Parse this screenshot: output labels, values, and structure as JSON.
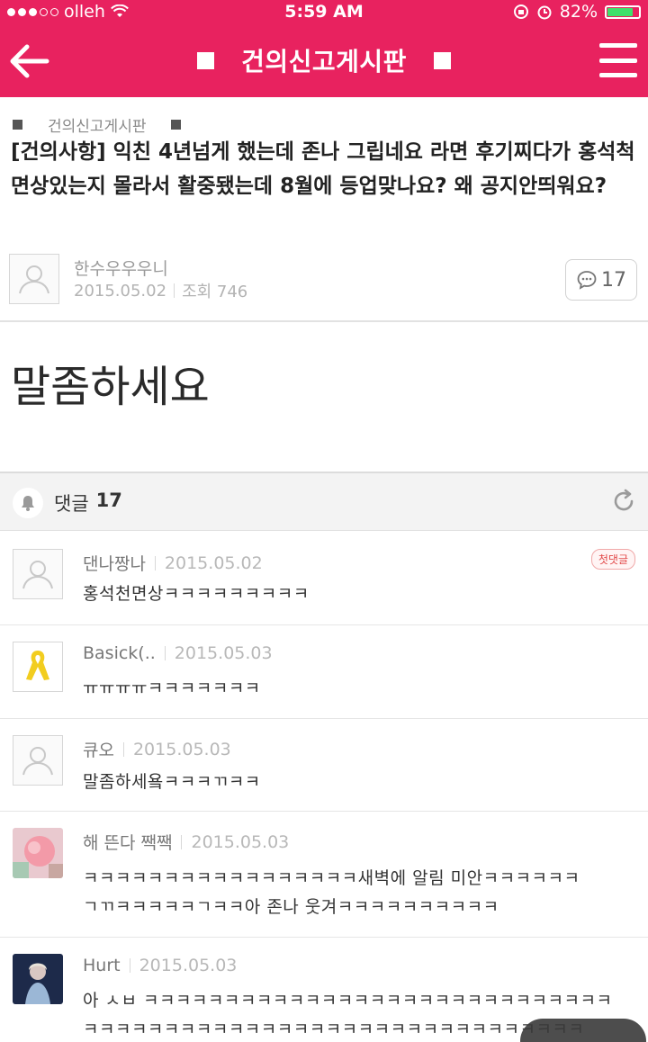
{
  "status_bar": {
    "carrier": "olleh",
    "time": "5:59 AM",
    "battery": "82%",
    "battery_level": 0.82
  },
  "header": {
    "title": "건의신고게시판"
  },
  "post": {
    "board": "건의신고게시판",
    "title": "[건의사항] 익친 4년넘게 했는데 존나 그립네요 라면 후기찌다가 홍석척 면상있는지 몰라서 활중됐는데 8월에 등업맞나요? 왜 공지안띄워요?",
    "author": "한수우우우니",
    "date": "2015.05.02",
    "views": "조회 746",
    "comment_count": "17",
    "body": "말좀하세요"
  },
  "comments_section": {
    "label": "댓글",
    "count": "17"
  },
  "comments": [
    {
      "author": "댄나짱나",
      "date": "2015.05.02",
      "badge": "첫댓글",
      "lines": [
        "홍석천면상ㅋㅋㅋㅋㅋㅋㅋㅋㅋ"
      ]
    },
    {
      "author": "Basick(..",
      "date": "2015.05.03",
      "lines": [
        "ㅠㅠㅠㅠㅋㅋㅋㅋㅋㅋㅋ"
      ]
    },
    {
      "author": "큐오",
      "date": "2015.05.03",
      "lines": [
        "말좀하세욬ㅋㅋㅋㄲㅋㅋ"
      ]
    },
    {
      "author": "해 뜬다 짹짹",
      "date": "2015.05.03",
      "lines": [
        "ㅋㅋㅋㅋㅋㅋㅋㅋㅋㅋㅋㅋㅋㅋㅋㅋㅋ새벽에 알림 미안ㅋㅋㅋㅋㅋㅋ",
        "ㄱㄲㅋㅋㅋㅋㅋㄱㅋㅋ아 존나 웃겨ㅋㅋㅋㅋㅋㅋㅋㅋㅋㅋ"
      ]
    },
    {
      "author": "Hurt",
      "date": "2015.05.03",
      "lines": [
        "아 ㅅㅂ ㅋㅋㅋㅋㅋㅋㅋㅋㅋㅋㅋㅋㅋㅋㅋㅋㅋㅋㅋㅋㅋㅋㅋㅋㅋㅋㅋㅋㅋ",
        "ㅋㅋㅋㅋㅋㅋㅋㅋㅋㅋㅋㅋㅋㅋㅋㅋㅋㅋㅋㅋㅋㅋㅋㅋㅋㅋㅋㅋㅋㅋㅋ"
      ]
    }
  ],
  "colors": {
    "brand": "#e8225f",
    "battery_green": "#3ee06b"
  },
  "icons": [
    "back-arrow-icon",
    "menu-icon",
    "comment-bubble-icon",
    "bell-icon",
    "refresh-icon",
    "default-avatar-icon",
    "wifi-icon",
    "alarm-icon",
    "lock-rotation-icon"
  ]
}
